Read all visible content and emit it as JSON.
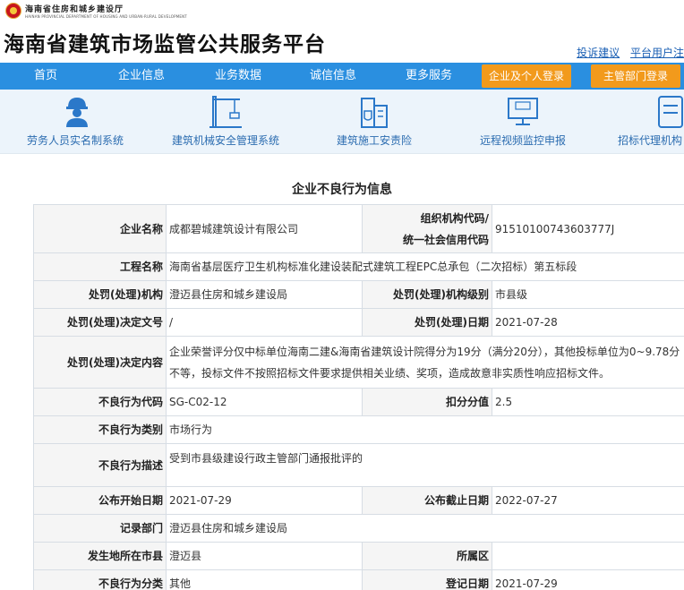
{
  "header": {
    "dept_name": "海南省住房和城乡建设厅",
    "dept_name_en": "HAINAN PROVINCIAL DEPARTMENT OF HOUSING AND URBAN-RURAL DEVELOPMENT",
    "site_title": "海南省建筑市场监管公共服务平台",
    "links": [
      "投诉建议",
      "平台用户注"
    ]
  },
  "nav": {
    "items": [
      "首页",
      "企业信息",
      "业务数据",
      "诚信信息",
      "更多服务"
    ],
    "login_buttons": [
      "企业及个人登录",
      "主管部门登录"
    ],
    "accent_color": "#f29a1c",
    "bar_color": "#2a8fe0"
  },
  "quick_links": [
    {
      "label": "劳务人员实名制系统",
      "icon": "worker-icon"
    },
    {
      "label": "建筑机械安全管理系统",
      "icon": "crane-icon"
    },
    {
      "label": "建筑施工安责险",
      "icon": "insurance-building-icon"
    },
    {
      "label": "远程视频监控申报",
      "icon": "monitor-report-icon"
    },
    {
      "label": "招标代理机构",
      "icon": "document-icon"
    }
  ],
  "section_title": "企业不良行为信息",
  "record": {
    "company_name_label": "企业名称",
    "company_name": "成都碧城建筑设计有限公司",
    "org_code_label_1": "组织机构代码/",
    "org_code_label_2": "统一社会信用代码",
    "org_code": "91510100743603777J",
    "project_label": "工程名称",
    "project": "海南省基层医疗卫生机构标准化建设装配式建筑工程EPC总承包（二次招标）第五标段",
    "authority_label": "处罚(处理)机构",
    "authority": "澄迈县住房和城乡建设局",
    "authority_level_label": "处罚(处理)机构级别",
    "authority_level": "市县级",
    "decision_no_label": "处罚(处理)决定文号",
    "decision_no": "/",
    "decision_date_label": "处罚(处理)日期",
    "decision_date": "2021-07-28",
    "decision_content_label": "处罚(处理)决定内容",
    "decision_content": "企业荣誉评分仅中标单位海南二建&海南省建筑设计院得分为19分（满分20分），其他投标单位为0~9.78分不等，投标文件不按照招标文件要求提供相关业绩、奖项，造成故意非实质性响应招标文件。",
    "code_label": "不良行为代码",
    "code": "SG-C02-12",
    "score_label": "扣分分值",
    "score": "2.5",
    "category_label": "不良行为类别",
    "category": "市场行为",
    "description_label": "不良行为描述",
    "description": "受到市县级建设行政主管部门通报批评的",
    "publish_start_label": "公布开始日期",
    "publish_start": "2021-07-29",
    "publish_end_label": "公布截止日期",
    "publish_end": "2022-07-27",
    "recorder_label": "记录部门",
    "recorder": "澄迈县住房和城乡建设局",
    "city_label": "发生地所在市县",
    "city": "澄迈县",
    "district_label": "所属区",
    "district": "",
    "classification_label": "不良行为分类",
    "classification": "其他",
    "register_date_label": "登记日期",
    "register_date": "2021-07-29"
  }
}
